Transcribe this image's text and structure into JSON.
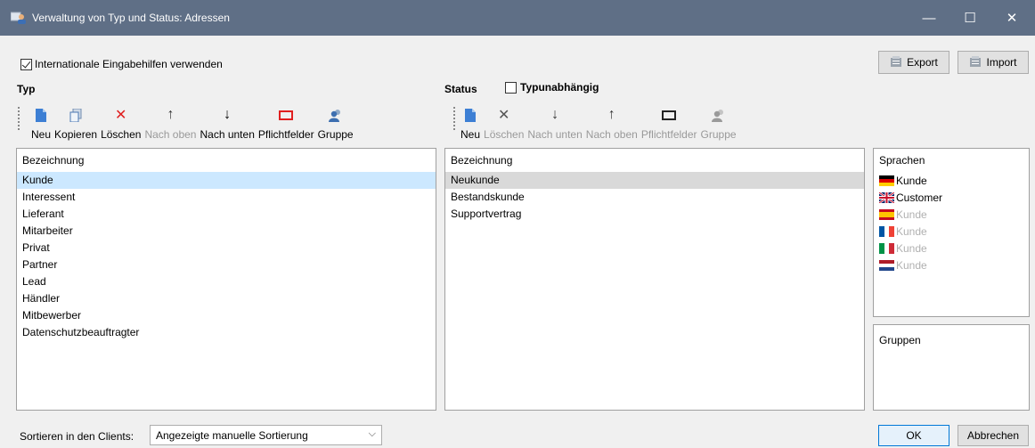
{
  "window": {
    "title": "Verwaltung von Typ und Status: Adressen",
    "minimize": "—",
    "maximize": "☐",
    "close": "✕"
  },
  "intl_checkbox": {
    "label": "Internationale Eingabehilfen verwenden",
    "checked": true
  },
  "top_buttons": {
    "export": "Export",
    "import": "Import"
  },
  "typ": {
    "label": "Typ",
    "toolbar": [
      {
        "name": "new",
        "label": "Neu",
        "icon": "document-icon",
        "disabled": false
      },
      {
        "name": "copy",
        "label": "Kopieren",
        "icon": "copy-icon",
        "disabled": false
      },
      {
        "name": "delete",
        "label": "Löschen",
        "icon": "delete-x-icon",
        "disabled": false
      },
      {
        "name": "move-up",
        "label": "Nach oben",
        "icon": "arrow-up-icon",
        "disabled": true
      },
      {
        "name": "move-down",
        "label": "Nach unten",
        "icon": "arrow-down-icon",
        "disabled": false
      },
      {
        "name": "required",
        "label": "Pflichtfelder",
        "icon": "required-fields-icon",
        "disabled": false
      },
      {
        "name": "group",
        "label": "Gruppe",
        "icon": "user-group-icon",
        "disabled": false
      }
    ],
    "column_header": "Bezeichnung",
    "items": [
      "Kunde",
      "Interessent",
      "Lieferant",
      "Mitarbeiter",
      "Privat",
      "Partner",
      "Lead",
      "Händler",
      "Mitbewerber",
      "Datenschutzbeauftragter"
    ],
    "selected": 0
  },
  "status": {
    "label": "Status",
    "type_independent": {
      "label": "Typunabhängig",
      "checked": false
    },
    "toolbar": [
      {
        "name": "new",
        "label": "Neu",
        "icon": "document-icon",
        "disabled": false
      },
      {
        "name": "delete",
        "label": "Löschen",
        "icon": "delete-x-icon",
        "disabled": true
      },
      {
        "name": "move-down",
        "label": "Nach unten",
        "icon": "arrow-down-icon",
        "disabled": true
      },
      {
        "name": "move-up",
        "label": "Nach oben",
        "icon": "arrow-up-icon",
        "disabled": true
      },
      {
        "name": "required",
        "label": "Pflichtfelder",
        "icon": "required-fields-icon",
        "disabled": true
      },
      {
        "name": "group",
        "label": "Gruppe",
        "icon": "user-group-icon",
        "disabled": true
      }
    ],
    "column_header": "Bezeichnung",
    "items": [
      "Neukunde",
      "Bestandskunde",
      "Supportvertrag"
    ],
    "selected": 0
  },
  "languages": {
    "header": "Sprachen",
    "items": [
      {
        "flag": "germany-flag-icon",
        "text": "Kunde",
        "dim": false
      },
      {
        "flag": "uk-flag-icon",
        "text": "Customer",
        "dim": false
      },
      {
        "flag": "spain-flag-icon",
        "text": "Kunde",
        "dim": true
      },
      {
        "flag": "france-flag-icon",
        "text": "Kunde",
        "dim": true
      },
      {
        "flag": "italy-flag-icon",
        "text": "Kunde",
        "dim": true
      },
      {
        "flag": "netherlands-flag-icon",
        "text": "Kunde",
        "dim": true
      }
    ]
  },
  "groups": {
    "header": "Gruppen"
  },
  "sort": {
    "label": "Sortieren in den Clients:",
    "value": "Angezeigte manuelle Sortierung"
  },
  "dialog_buttons": {
    "ok": "OK",
    "cancel": "Abbrechen"
  },
  "colors": {
    "titlebar": "#5f6f86",
    "selection_blue": "#cce8ff",
    "selection_gray": "#d9d9d9",
    "delete_red": "#e02020",
    "accent": "#0078d7"
  }
}
